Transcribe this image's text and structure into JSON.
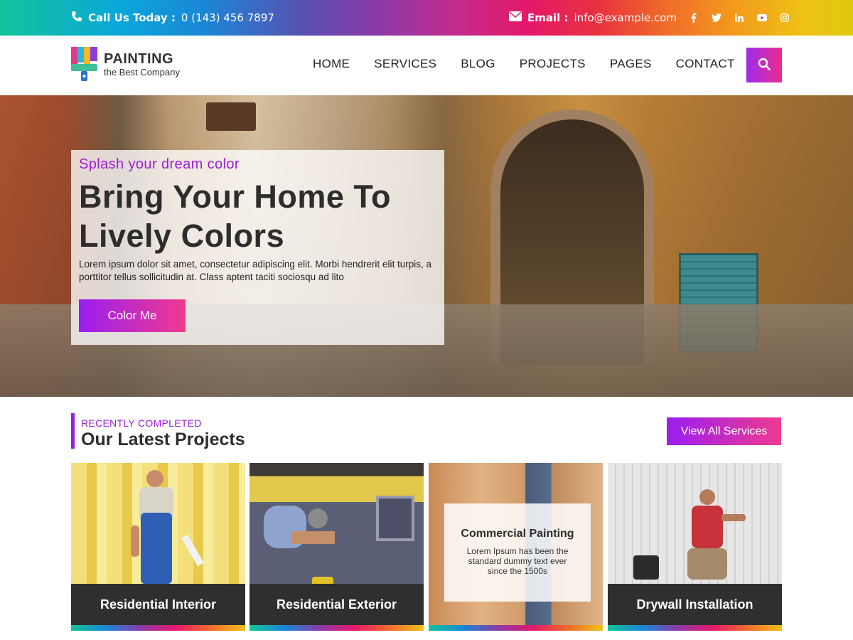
{
  "topbar": {
    "call_label": "Call Us Today :",
    "call_value": "0 (143) 456 7897",
    "email_label": "Email :",
    "email_value": "info@example.com",
    "social": [
      "f",
      "t",
      "in",
      "yt",
      "ig"
    ]
  },
  "header": {
    "logo_name": "PAINTING",
    "logo_tagline": "the Best Company",
    "nav": [
      "HOME",
      "SERVICES",
      "BLOG",
      "PROJECTS",
      "PAGES",
      "CONTACT"
    ]
  },
  "hero": {
    "kicker": "Splash your dream color",
    "title_line1": "Bring Your Home To",
    "title_line2": "Lively Colors",
    "description": "Lorem ipsum dolor sit amet, consectetur adipiscing elit. Morbi hendrerit elit turpis, a porttitor tellus sollicitudin at. Class aptent taciti sociosqu ad lito",
    "cta": "Color Me"
  },
  "projects": {
    "kicker": "RECENTLY COMPLETED",
    "title": "Our Latest Projects",
    "view_all": "View All Services",
    "cards": [
      {
        "title": "Residential Interior"
      },
      {
        "title": "Residential Exterior"
      },
      {
        "title": "Commercial Painting",
        "description": "Lorem Ipsum has been the standard dummy text ever since the 1500s"
      },
      {
        "title": "Drywall Installation"
      }
    ]
  },
  "colors": {
    "accent_purple": "#9b1fe0",
    "accent_pink": "#f03a8f",
    "dark_caption": "#2f2f2f"
  }
}
